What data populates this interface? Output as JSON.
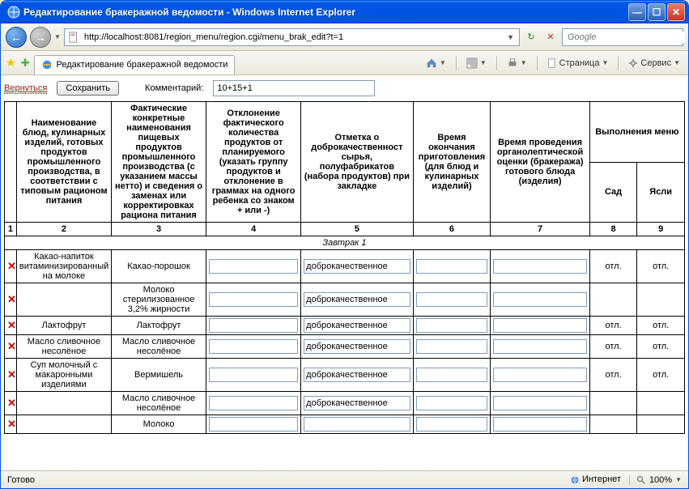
{
  "window": {
    "title": "Редактирование бракеражной ведомости - Windows Internet Explorer"
  },
  "nav": {
    "url": "http://localhost:8081/region_menu/region.cgi/menu_brak_edit?t=1",
    "search_placeholder": "Google"
  },
  "tab": {
    "title": "Редактирование бракеражной ведомости"
  },
  "cmdbar": {
    "page": "Страница",
    "service": "Сервис"
  },
  "controls": {
    "back_link": "Вернуться",
    "save_btn": "Сохранить",
    "comment_label": "Комментарий:",
    "comment_value": "10+15+1"
  },
  "headers": {
    "c1": "Наименование блюд, кулинарных изделий, готовых продуктов промышленного производства, в соответствии с типовым рационом питания",
    "c2": "Фактические конкретные наименования пищевых продуктов промышленного производства (с указанием массы нетто) и сведения о заменах или корректировках рациона питания",
    "c3": "Отклонение фактического количества продуктов от планируемого (указать группу продуктов и отклонение в граммах на одного ребенка со знаком + или -)",
    "c4": "Отметка о доброкачественност сырья, полуфабрикатов (набора продуктов) при закладке",
    "c5": "Время окончания приготовления (для блюд и кулинарных изделий)",
    "c6": "Время проведения органолептической оценки (бракеража) готового блюда (изделия)",
    "c7": "Выполнения меню",
    "c7a": "Сад",
    "c7b": "Ясли",
    "n1": "1",
    "n2": "2",
    "n3": "3",
    "n4": "4",
    "n5": "5",
    "n6": "6",
    "n7": "7",
    "n8": "8",
    "n9": "9"
  },
  "section": {
    "breakfast": "Завтрак 1"
  },
  "rows": [
    {
      "dish": "Какао-напиток витаминизированный на молоке",
      "product": "Какао-порошок",
      "dev": "",
      "quality": "доброкачественное",
      "t_end": "",
      "t_check": "",
      "sad": "отл.",
      "yasli": "отл."
    },
    {
      "dish": "",
      "product": "Молоко стерилизованное 3,2% жирности",
      "dev": "",
      "quality": "доброкачественное",
      "t_end": "",
      "t_check": "",
      "sad": "",
      "yasli": ""
    },
    {
      "dish": "Лактофрут",
      "product": "Лактофрут",
      "dev": "",
      "quality": "доброкачественное",
      "t_end": "",
      "t_check": "",
      "sad": "отл.",
      "yasli": "отл."
    },
    {
      "dish": "Масло сливочное несолёное",
      "product": "Масло сливочное несолёное",
      "dev": "",
      "quality": "доброкачественное",
      "t_end": "",
      "t_check": "",
      "sad": "отл.",
      "yasli": "отл."
    },
    {
      "dish": "Суп молочный с макаронными изделиями",
      "product": "Вермишель",
      "dev": "",
      "quality": "доброкачественное",
      "t_end": "",
      "t_check": "",
      "sad": "отл.",
      "yasli": "отл."
    },
    {
      "dish": "",
      "product": "Масло сливочное несолёное",
      "dev": "",
      "quality": "доброкачественное",
      "t_end": "",
      "t_check": "",
      "sad": "",
      "yasli": ""
    },
    {
      "dish": "",
      "product": "Молоко",
      "dev": "",
      "quality": "",
      "t_end": "",
      "t_check": "",
      "sad": "",
      "yasli": ""
    }
  ],
  "status": {
    "ready": "Готово",
    "zone": "Интернет",
    "zoom": "100%"
  }
}
